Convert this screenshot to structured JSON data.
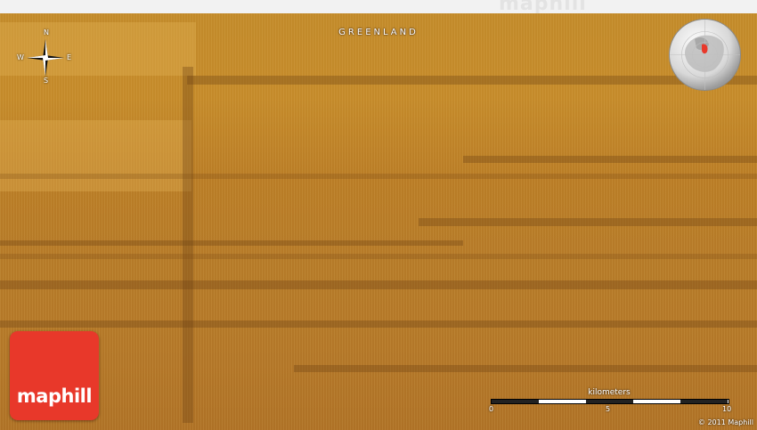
{
  "map": {
    "region_label": "GREENLAND",
    "terrain_color": "#c08428",
    "compass": {
      "n": "N",
      "s": "S",
      "e": "E",
      "w": "W"
    },
    "logo": {
      "text": "maphill",
      "color": "#e8382a"
    },
    "watermark": "maphill",
    "scale": {
      "unit": "kilometers",
      "ticks": [
        "0",
        "5",
        "10"
      ]
    },
    "copyright": "© 2011 Maphill"
  }
}
